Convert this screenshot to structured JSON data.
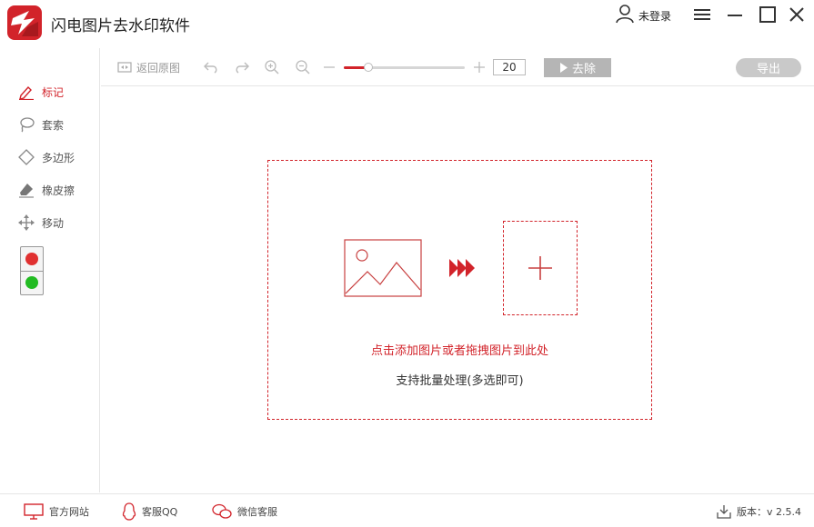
{
  "app": {
    "title": "闪电图片去水印软件",
    "accent_color": "#d2232a",
    "logo_icon": "lightning-pen-logo"
  },
  "header": {
    "user_label": "未登录",
    "user_icon": "user-icon",
    "window_controls": [
      "menu-icon",
      "minimize-icon",
      "maximize-icon",
      "close-icon"
    ]
  },
  "sidebar": {
    "tools": [
      {
        "label": "标记",
        "icon": "pen-icon",
        "active": true
      },
      {
        "label": "套索",
        "icon": "lasso-icon",
        "active": false
      },
      {
        "label": "多边形",
        "icon": "polygon-icon",
        "active": false
      },
      {
        "label": "橡皮擦",
        "icon": "eraser-icon",
        "active": false
      },
      {
        "label": "移动",
        "icon": "move-icon",
        "active": false
      }
    ],
    "colors": [
      "#e03030",
      "#22bb22"
    ]
  },
  "toolbar": {
    "back_label": "返回原图",
    "zoom_value": "20",
    "zoom_fraction": 0.2,
    "remove_label": "去除",
    "export_label": "导出"
  },
  "dropzone": {
    "primary_text": "点击添加图片或者拖拽图片到此处",
    "secondary_text": "支持批量处理(多选即可)"
  },
  "statusbar": {
    "website_label": "官方网站",
    "qq_label": "客服QQ",
    "wechat_label": "微信客服",
    "version_label": "版本：v 2.5.4"
  }
}
